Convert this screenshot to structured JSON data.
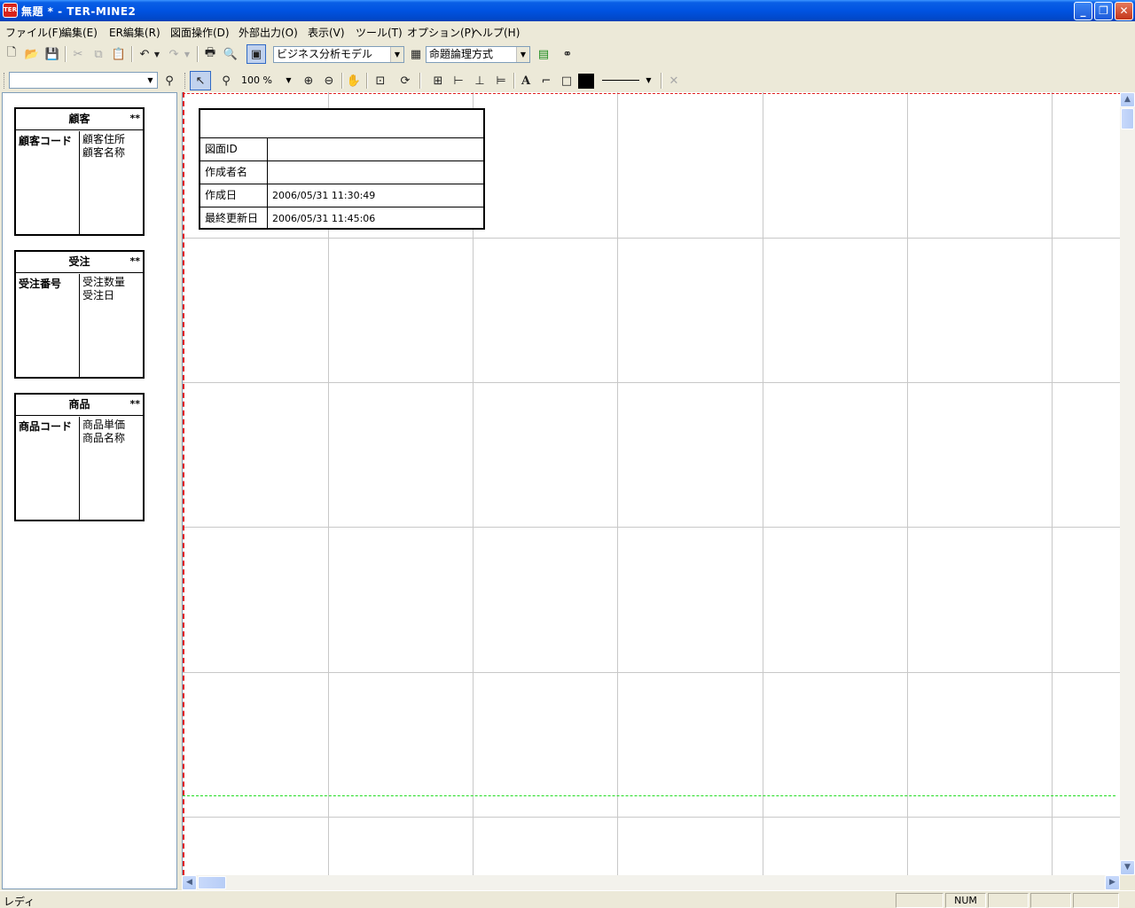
{
  "window": {
    "title": "無題 * - TER-MINE2",
    "icon_label": "TER",
    "minimize": "_",
    "restore": "❐",
    "close": "✕"
  },
  "menu": [
    "ファイル(F)",
    "編集(E)",
    "ER編集(R)",
    "図面操作(D)",
    "外部出力(O)",
    "表示(V)",
    "ツール(T)",
    "オプション(P)",
    "ヘルプ(H)"
  ],
  "toolbar1": {
    "model_select": "ビジネス分析モデル",
    "method_select": "命題論理方式"
  },
  "toolbar2": {
    "zoom": "100 %"
  },
  "leftpane": {
    "filter_value": "",
    "entities": [
      {
        "name": "顧客",
        "marker": "**",
        "key": "顧客コード",
        "attrs": [
          "顧客住所",
          "顧客名称"
        ]
      },
      {
        "name": "受注",
        "marker": "**",
        "key": "受注番号",
        "attrs": [
          "受注数量",
          "受注日"
        ]
      },
      {
        "name": "商品",
        "marker": "**",
        "key": "商品コード",
        "attrs": [
          "商品単価",
          "商品名称"
        ]
      }
    ]
  },
  "info_table": {
    "title": "",
    "rows": [
      {
        "label": "図面ID",
        "value": ""
      },
      {
        "label": "作成者名",
        "value": ""
      },
      {
        "label": "作成日",
        "value": "2006/05/31 11:30:49"
      },
      {
        "label": "最終更新日",
        "value": "2006/05/31 11:45:06"
      }
    ]
  },
  "status": {
    "text": "レディ",
    "num": "NUM"
  }
}
